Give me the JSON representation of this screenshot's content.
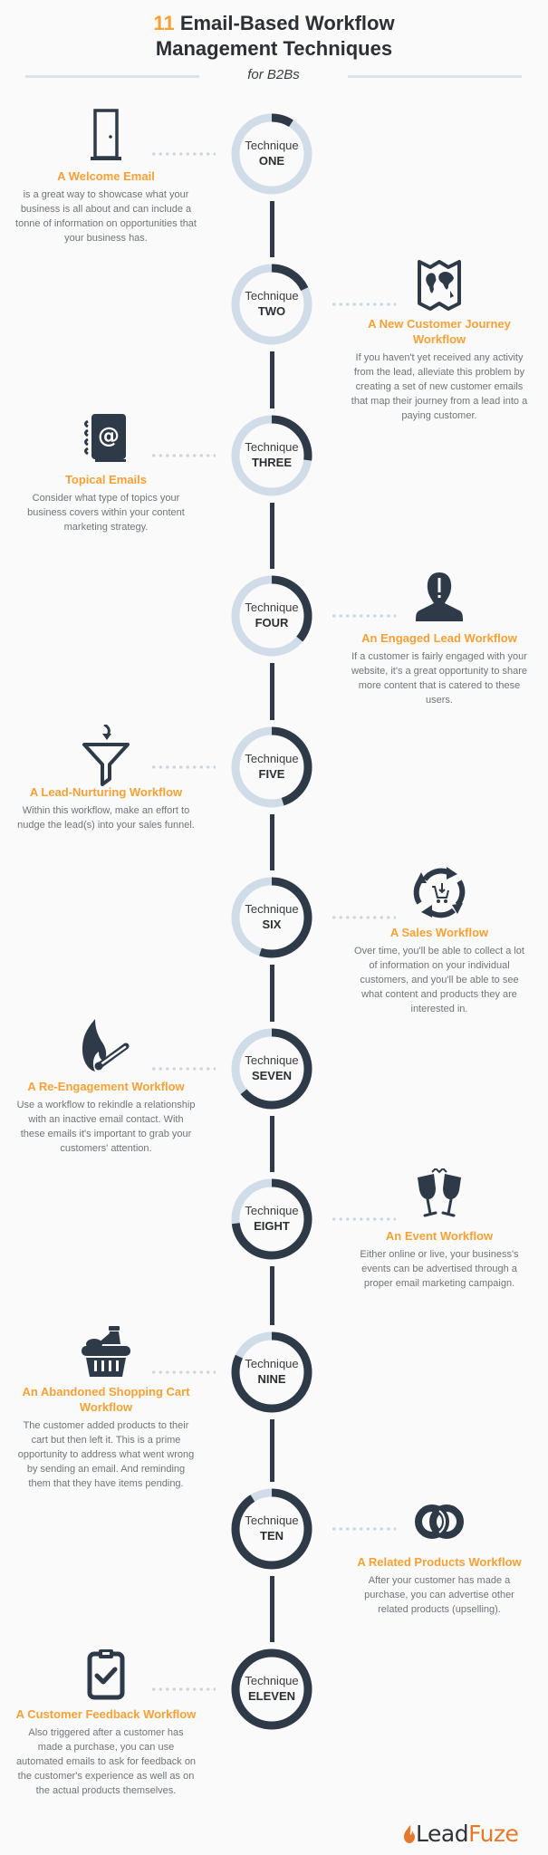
{
  "header": {
    "title_number": "11",
    "title_line1_rest": "Email-Based Workflow",
    "title_line2": "Management Techniques",
    "subtitle": "for B2Bs"
  },
  "colors": {
    "accent": "#f7a035",
    "dark": "#2e3a48",
    "ring_track": "#d0dde8",
    "text": "#6f7479"
  },
  "ring_label": "Technique",
  "techniques": [
    {
      "number_word": "ONE",
      "progress": 0.09,
      "side": "left",
      "icon": "door-icon",
      "heading": "A Welcome Email",
      "description": "is a great way to showcase what your business is all about and can include a tonne of information on opportunities that your business has."
    },
    {
      "number_word": "TWO",
      "progress": 0.18,
      "side": "right",
      "icon": "world-map-icon",
      "heading": "A New Customer Journey Workflow",
      "description": "If you haven't yet received any activity from the lead, alleviate this problem by creating a set of new customer emails that map their journey from a lead into a paying customer."
    },
    {
      "number_word": "THREE",
      "progress": 0.27,
      "side": "left",
      "icon": "address-book-icon",
      "heading": "Topical Emails",
      "description": "Consider what type of topics your business covers within your content marketing strategy."
    },
    {
      "number_word": "FOUR",
      "progress": 0.36,
      "side": "right",
      "icon": "alert-person-icon",
      "heading": "An Engaged Lead Workflow",
      "description": "If a customer is fairly engaged with your website, it's a great opportunity to share more content that is catered to these users."
    },
    {
      "number_word": "FIVE",
      "progress": 0.45,
      "side": "left",
      "icon": "funnel-icon",
      "heading": "A Lead-Nurturing Workflow",
      "description": "Within this workflow, make an effort to nudge the lead(s) into your sales funnel."
    },
    {
      "number_word": "SIX",
      "progress": 0.55,
      "side": "right",
      "icon": "cart-cycle-icon",
      "heading": "A Sales Workflow",
      "description": "Over time, you'll be able to collect a lot of information on your individual customers, and you'll be able to see what content and products they are interested in."
    },
    {
      "number_word": "SEVEN",
      "progress": 0.64,
      "side": "left",
      "icon": "match-flame-icon",
      "heading": "A Re-Engagement Workflow",
      "description": "Use a workflow to rekindle a relationship with an inactive email contact. With these emails it's important to grab your customers' attention."
    },
    {
      "number_word": "EIGHT",
      "progress": 0.73,
      "side": "right",
      "icon": "champagne-toast-icon",
      "heading": "An Event Workflow",
      "description": "Either online or live, your business's events can be advertised through a proper email marketing campaign."
    },
    {
      "number_word": "NINE",
      "progress": 0.82,
      "side": "left",
      "icon": "shopping-basket-icon",
      "heading": "An Abandoned Shopping Cart Workflow",
      "description": "The customer added products to their cart but then left it. This is a prime opportunity to address what went wrong by sending an email. And reminding them that they have items pending."
    },
    {
      "number_word": "TEN",
      "progress": 0.91,
      "side": "right",
      "icon": "linked-rings-icon",
      "heading": "A Related Products Workflow",
      "description": "After your customer has made a purchase, you can advertise other related products (upselling)."
    },
    {
      "number_word": "ELEVEN",
      "progress": 1.0,
      "side": "left",
      "icon": "clipboard-check-icon",
      "heading": "A Customer Feedback Workflow",
      "description": "Also triggered after a customer has made a purchase, you can use automated emails to ask for feedback on the customer's experience as well as on the actual products themselves."
    }
  ],
  "footer": {
    "logo_part1": "Lead",
    "logo_part2": "Fuze"
  }
}
